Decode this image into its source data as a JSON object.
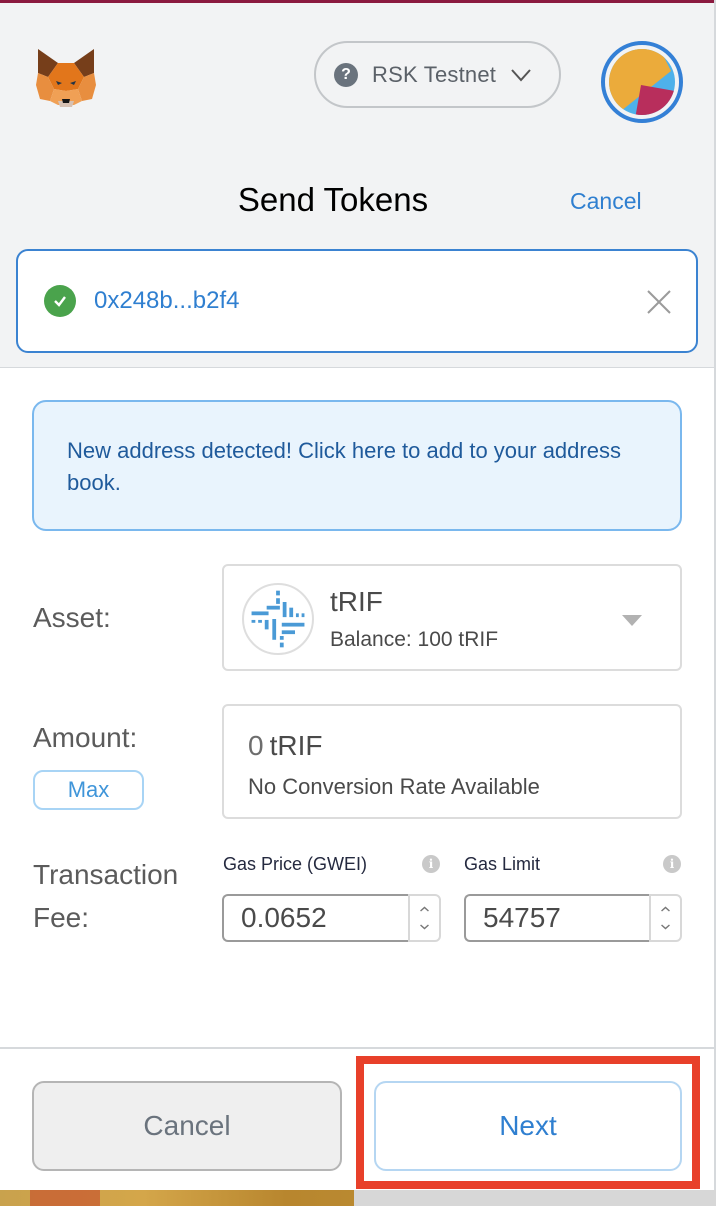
{
  "header": {
    "logo": "metamask-fox-icon",
    "network": {
      "label": "RSK Testnet",
      "icon": "question-circle-icon"
    },
    "avatar": "account-identicon",
    "title": "Send Tokens",
    "cancel_label": "Cancel"
  },
  "recipient": {
    "address": "0x248b...b2f4",
    "status_icon": "check-circle-icon",
    "clear_icon": "close-icon"
  },
  "notice": {
    "text": "New address detected! Click here to add to your address book."
  },
  "form": {
    "asset": {
      "label": "Asset:",
      "token_symbol": "tRIF",
      "balance": "Balance: 100 tRIF",
      "icon": "rif-token-icon"
    },
    "amount": {
      "label": "Amount:",
      "max_label": "Max",
      "value": "0",
      "unit": "tRIF",
      "conversion": "No Conversion Rate Available"
    },
    "fee": {
      "label_line1": "Transaction",
      "label_line2": "Fee:",
      "gas_price_label": "Gas Price (GWEI)",
      "gas_price_value": "0.0652",
      "gas_limit_label": "Gas Limit",
      "gas_limit_value": "54757"
    }
  },
  "footer": {
    "cancel_label": "Cancel",
    "next_label": "Next"
  },
  "colors": {
    "accent": "#2f7fd0",
    "highlight": "#e8402a",
    "success": "#4aa34c"
  }
}
